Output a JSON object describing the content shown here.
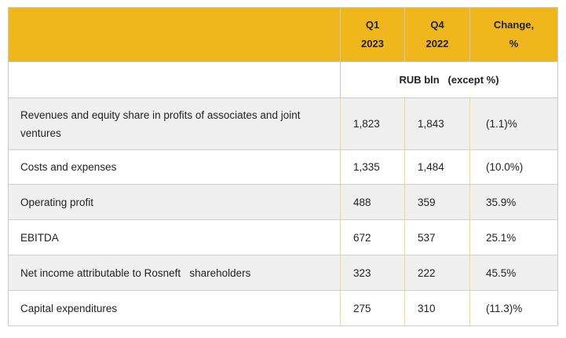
{
  "header": {
    "col1": "",
    "q1_line1": "Q1",
    "q1_line2": "2023",
    "q4_line1": "Q4",
    "q4_line2": "2022",
    "change_line1": "Change,",
    "change_line2": "%"
  },
  "unit_label": "RUB bln   (except %)",
  "rows": [
    {
      "label": "Revenues and equity share in   profits of associates and joint ventures",
      "q1_2023": "1,823",
      "q4_2022": "1,843",
      "change": "(1.1)%"
    },
    {
      "label": "Costs and expenses",
      "q1_2023": "1,335",
      "q4_2022": "1,484",
      "change": "(10.0%)"
    },
    {
      "label": "Operating profit",
      "q1_2023": "488",
      "q4_2022": "359",
      "change": "35.9%"
    },
    {
      "label": "EBITDA",
      "q1_2023": "672",
      "q4_2022": "537",
      "change": "25.1%"
    },
    {
      "label": "Net income attributable to Rosneft   shareholders",
      "q1_2023": "323",
      "q4_2022": "222",
      "change": "45.5%"
    },
    {
      "label": "Capital expenditures",
      "q1_2023": "275",
      "q4_2022": "310",
      "change": "(11.3)%"
    }
  ],
  "colors": {
    "header_bg": "#f0b71c",
    "row_alt_bg": "#f0f0f0",
    "row_bg": "#ffffff"
  }
}
